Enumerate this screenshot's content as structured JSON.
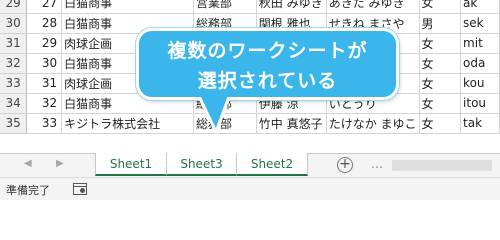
{
  "grid": {
    "rows": [
      {
        "row": "29",
        "cells": [
          "27",
          "白猫商事",
          "営業部",
          "秋田 みゆき",
          "あきた みゆき",
          "女",
          "ak"
        ]
      },
      {
        "row": "30",
        "cells": [
          "28",
          "白猫商事",
          "総務部",
          "関根 雅也",
          "せきね まさや",
          "男",
          "sek"
        ]
      },
      {
        "row": "31",
        "cells": [
          "29",
          "肉球企画",
          "",
          "",
          "",
          "女",
          "mit"
        ]
      },
      {
        "row": "32",
        "cells": [
          "30",
          "白猫商事",
          "",
          "",
          "",
          "女",
          "oda"
        ]
      },
      {
        "row": "33",
        "cells": [
          "31",
          "肉球企画",
          "",
          "",
          "",
          "女",
          "kou"
        ]
      },
      {
        "row": "34",
        "cells": [
          "32",
          "白猫商事",
          "総務部",
          "伊藤 涼",
          "いとうり",
          "女",
          "itou"
        ]
      },
      {
        "row": "35",
        "cells": [
          "33",
          "キジトラ株式会社",
          "総務部",
          "竹中 真悠子",
          "たけなか まゆこ",
          "女",
          "tak"
        ]
      }
    ]
  },
  "callout": {
    "line1": "複数のワークシートが",
    "line2": "選択されている",
    "color": "#3bb6ea"
  },
  "tabs": {
    "prev_icon": "scroll-left-icon",
    "next_icon": "scroll-right-icon",
    "items": [
      {
        "label": "Sheet1"
      },
      {
        "label": "Sheet3"
      },
      {
        "label": "Sheet2"
      }
    ],
    "add_label": "+",
    "more_label": "…",
    "active_color": "#217346"
  },
  "status": {
    "ready": "準備完了",
    "macro_icon": "macro-record-icon"
  }
}
